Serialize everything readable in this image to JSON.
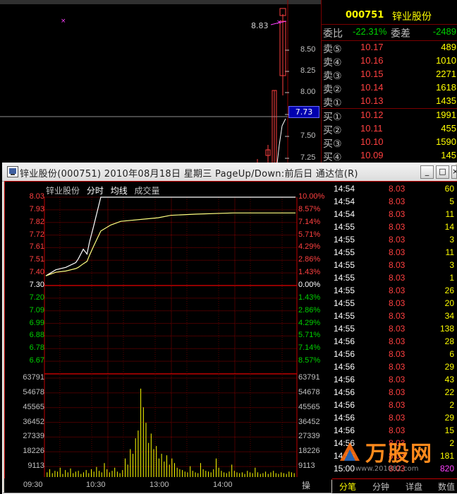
{
  "colors": {
    "background": "#000000",
    "grid": "#8b0000",
    "up": "#ff4040",
    "down": "#00d000",
    "flat": "#ffffff",
    "volume": "#ffff00",
    "price_line": "#ffffff",
    "avg_line": "#ffff80",
    "accent_blue": "#0000b0"
  },
  "background_chart": {
    "price_ticks": [
      "8.50",
      "8.25",
      "8.00",
      "7.75",
      "7.50",
      "7.25"
    ],
    "high_label": "8.83",
    "cursor_value": "7.73"
  },
  "order_book": {
    "code": "000751",
    "name": "锌业股份",
    "ratio_label": "委比",
    "ratio_value": "-22.31%",
    "diff_label": "委差",
    "diff_value": "-2489",
    "asks": [
      {
        "label": "卖⑤",
        "price": "10.17",
        "volume": "489"
      },
      {
        "label": "卖④",
        "price": "10.16",
        "volume": "1010"
      },
      {
        "label": "卖③",
        "price": "10.15",
        "volume": "2271"
      },
      {
        "label": "卖②",
        "price": "10.14",
        "volume": "1618"
      },
      {
        "label": "卖①",
        "price": "10.13",
        "volume": "1435"
      }
    ],
    "bids": [
      {
        "label": "买①",
        "price": "10.12",
        "volume": "1991"
      },
      {
        "label": "买②",
        "price": "10.11",
        "volume": "455"
      },
      {
        "label": "买③",
        "price": "10.10",
        "volume": "1590"
      },
      {
        "label": "买④",
        "price": "10.09",
        "volume": "145"
      }
    ]
  },
  "window": {
    "title": "锌业股份(000751) 2010年08月18日 星期三 PageUp/Down:前后日 通达信(R)",
    "buttons": {
      "minimize": "_",
      "maximize": "□",
      "close": "×"
    }
  },
  "legend": {
    "name": "锌业股份",
    "chart_mode": "分时",
    "avg_line": "均线",
    "volume": "成交量"
  },
  "price_axis": {
    "left": [
      "8.03",
      "7.93",
      "7.82",
      "7.72",
      "7.61",
      "7.51",
      "7.40",
      "7.30",
      "7.20",
      "7.09",
      "6.99",
      "6.88",
      "6.78",
      "6.67"
    ],
    "right": [
      "10.00%",
      "8.57%",
      "7.14%",
      "5.71%",
      "4.29%",
      "2.86%",
      "1.43%",
      "0.00%",
      "1.43%",
      "2.86%",
      "4.29%",
      "5.71%",
      "7.14%",
      "8.57%"
    ]
  },
  "volume_axis": [
    "63791",
    "54678",
    "45565",
    "36452",
    "27339",
    "18226",
    "9113"
  ],
  "time_axis": [
    "09:30",
    "10:30",
    "13:00",
    "14:00"
  ],
  "chart_data": {
    "type": "line",
    "x": [
      "09:30",
      "09:45",
      "10:00",
      "10:15",
      "10:20",
      "10:25",
      "10:30",
      "10:32",
      "10:35",
      "10:40",
      "10:50",
      "11:00",
      "11:30",
      "13:00",
      "13:30",
      "14:00",
      "14:30",
      "15:00"
    ],
    "series": [
      {
        "name": "分时",
        "values": [
          7.38,
          7.43,
          7.45,
          7.49,
          7.52,
          7.6,
          7.56,
          7.66,
          7.78,
          8.03,
          8.03,
          8.03,
          8.03,
          8.03,
          8.03,
          8.03,
          8.03,
          8.03
        ]
      },
      {
        "name": "均线",
        "values": [
          7.38,
          7.41,
          7.42,
          7.44,
          7.45,
          7.48,
          7.5,
          7.55,
          7.62,
          7.75,
          7.8,
          7.83,
          7.86,
          7.88,
          7.89,
          7.9,
          7.9,
          7.9
        ]
      }
    ],
    "ylim": [
      6.57,
      8.03
    ],
    "prev_close": 7.3,
    "volume": {
      "ylim": [
        0,
        63791
      ],
      "values": [
        3000,
        5000,
        2500,
        4000,
        3500,
        6000,
        2000,
        4500,
        3000,
        5500,
        2500,
        3500,
        4000,
        2000,
        3000,
        4500,
        2500,
        5000,
        3500,
        6500,
        4000,
        3000,
        9000,
        5000,
        3000,
        4000,
        6000,
        3500,
        2500,
        4500,
        12000,
        8000,
        18000,
        15000,
        25000,
        30000,
        57000,
        45000,
        35000,
        22000,
        28000,
        18000,
        20000,
        12000,
        15000,
        10000,
        14000,
        8000,
        12000,
        9000,
        6000,
        5000,
        4500,
        3500,
        3000,
        7000,
        4000,
        3000,
        2500,
        9000,
        5000,
        4000,
        3500,
        3000,
        5000,
        12000,
        6000,
        4000,
        3000,
        2500,
        3500,
        8000,
        4000,
        3000,
        2500,
        3000,
        2000,
        4000,
        3000,
        2500,
        6000,
        3000,
        2000,
        2500,
        3500,
        2000,
        3000,
        4000,
        2500,
        2000,
        3000,
        2500,
        2000,
        3500,
        3000,
        2500
      ]
    }
  },
  "trades": [
    {
      "time": "14:54",
      "price": "8.03",
      "volume": "60"
    },
    {
      "time": "14:54",
      "price": "8.03",
      "volume": "5"
    },
    {
      "time": "14:54",
      "price": "8.03",
      "volume": "11"
    },
    {
      "time": "14:55",
      "price": "8.03",
      "volume": "14"
    },
    {
      "time": "14:55",
      "price": "8.03",
      "volume": "3"
    },
    {
      "time": "14:55",
      "price": "8.03",
      "volume": "11"
    },
    {
      "time": "14:55",
      "price": "8.03",
      "volume": "3"
    },
    {
      "time": "14:55",
      "price": "8.03",
      "volume": "1"
    },
    {
      "time": "14:55",
      "price": "8.03",
      "volume": "26"
    },
    {
      "time": "14:55",
      "price": "8.03",
      "volume": "20"
    },
    {
      "time": "14:55",
      "price": "8.03",
      "volume": "34"
    },
    {
      "time": "14:55",
      "price": "8.03",
      "volume": "138"
    },
    {
      "time": "14:56",
      "price": "8.03",
      "volume": "28"
    },
    {
      "time": "14:56",
      "price": "8.03",
      "volume": "6"
    },
    {
      "time": "14:56",
      "price": "8.03",
      "volume": "29"
    },
    {
      "time": "14:56",
      "price": "8.03",
      "volume": "43"
    },
    {
      "time": "14:56",
      "price": "8.03",
      "volume": "22"
    },
    {
      "time": "14:56",
      "price": "8.03",
      "volume": "2"
    },
    {
      "time": "14:56",
      "price": "8.03",
      "volume": "29"
    },
    {
      "time": "14:56",
      "price": "8.03",
      "volume": "15"
    },
    {
      "time": "14:56",
      "price": "8.03",
      "volume": "2"
    },
    {
      "time": "14:56",
      "price": "8.03",
      "volume": "181"
    },
    {
      "time": "15:00",
      "price": "8.03",
      "volume": "820"
    }
  ],
  "tabs": {
    "bottom_left": "操",
    "items": [
      "分笔",
      "分钟",
      "详盘",
      "数值"
    ]
  },
  "watermark": {
    "text": "万股网",
    "url": "www.201082.com"
  }
}
